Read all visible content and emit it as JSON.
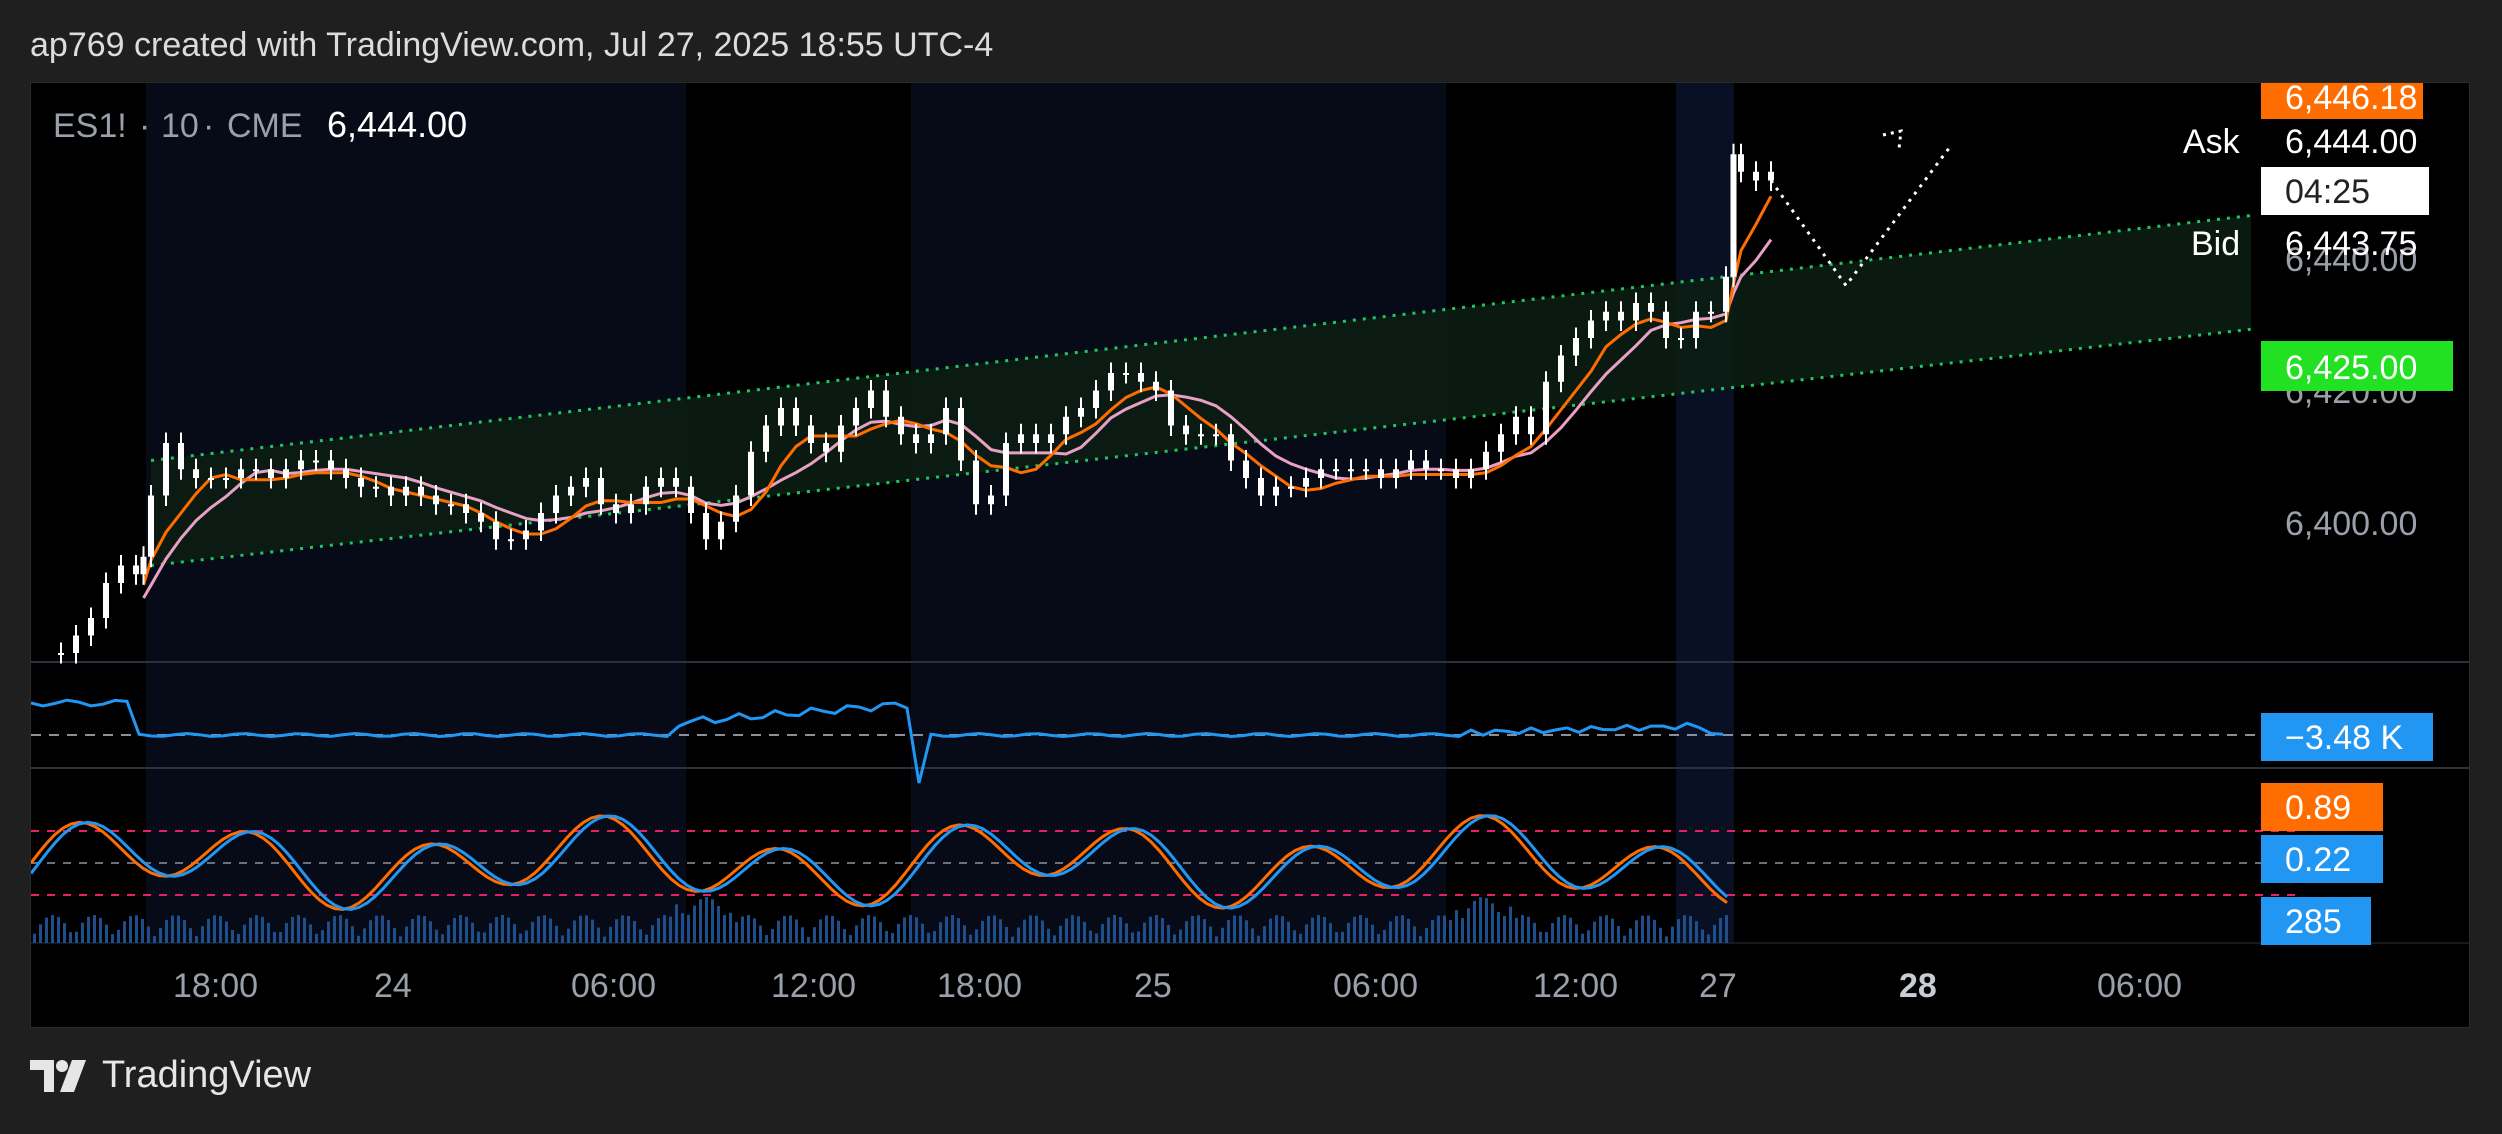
{
  "header": {
    "caption": "ap769 created with TradingView.com, Jul 27, 2025 18:55 UTC-4"
  },
  "footer": {
    "brand": "TradingView"
  },
  "symbol": {
    "ticker": "ES1!",
    "sep1": "·",
    "interval": "10",
    "sep2": "·",
    "exchange": "CME",
    "last": "6,444.00"
  },
  "quote": {
    "ask_label": "Ask",
    "ask_value": "6,444.00",
    "bid_label": "Bid",
    "bid_value": "6,443.75",
    "countdown": "04:25",
    "top_tag": "6,446.18",
    "level_tag": "6,425.00"
  },
  "colors": {
    "up_candle": "#ffffff",
    "orange_line": "#ff6d00",
    "pink_line": "#e8a0c4",
    "channel": "#22c55e",
    "blue": "#2196f3",
    "orange_tag": "#ff6d00",
    "green_tag": "#22e022",
    "pink_dashed": "#e91e63"
  },
  "chart_data": {
    "type": "line",
    "price_axis": {
      "ticks": [
        "6,400.00",
        "6,420.00",
        "6,440.00"
      ],
      "ylim": [
        6388,
        6452
      ]
    },
    "time_axis": {
      "ticks": [
        "18:00",
        "24",
        "06:00",
        "12:00",
        "18:00",
        "25",
        "06:00",
        "12:00",
        "27",
        "28",
        "06:00"
      ]
    },
    "price_series": {
      "x": [
        0,
        10,
        20,
        30,
        40,
        50,
        55,
        60,
        70,
        80,
        90,
        100,
        110,
        120,
        130,
        140,
        150,
        160,
        170,
        180,
        190,
        200,
        210,
        220,
        230,
        240,
        250,
        260,
        270,
        280,
        290,
        300,
        310,
        320,
        330,
        340,
        350,
        360,
        370,
        380,
        390,
        400,
        410,
        420,
        430,
        440,
        450,
        460,
        470,
        480,
        490,
        500,
        510,
        520,
        530,
        540,
        550,
        560,
        570,
        580,
        590,
        600,
        610,
        620,
        630,
        640,
        650,
        660,
        670,
        680,
        690,
        700,
        710,
        720,
        730,
        740,
        750,
        760,
        770,
        780,
        790,
        800,
        810,
        820,
        830,
        840,
        850,
        860,
        870,
        880,
        890,
        900,
        910,
        920,
        930,
        940,
        950,
        960,
        970,
        980,
        990,
        1000,
        1010,
        1020,
        1030,
        1040,
        1050,
        1060,
        1070,
        1080,
        1090,
        1100,
        1110,
        1115,
        1120,
        1130,
        1140
      ],
      "y": [
        6388,
        6390,
        6392,
        6396,
        6398,
        6397,
        6399,
        6406,
        6412,
        6409,
        6408,
        6408,
        6408,
        6409,
        6409,
        6408,
        6409,
        6410,
        6410,
        6409,
        6408,
        6407,
        6407,
        6406,
        6407,
        6406,
        6405,
        6405,
        6404,
        6403,
        6401,
        6401,
        6402,
        6404,
        6406,
        6407,
        6408,
        6405,
        6404,
        6405,
        6407,
        6408,
        6407,
        6404,
        6401,
        6403,
        6406,
        6411,
        6414,
        6416,
        6414,
        6412,
        6411,
        6414,
        6416,
        6418,
        6415,
        6413,
        6412,
        6413,
        6416,
        6410,
        6405,
        6406,
        6412,
        6413,
        6412,
        6413,
        6415,
        6416,
        6418,
        6420,
        6420,
        6419,
        6418,
        6414,
        6413,
        6413,
        6413,
        6410,
        6408,
        6406,
        6407,
        6407,
        6408,
        6409,
        6409,
        6409,
        6409,
        6408,
        6409,
        6410,
        6409,
        6409,
        6408,
        6409,
        6411,
        6413,
        6415,
        6413,
        6419,
        6422,
        6424,
        6426,
        6427,
        6426,
        6428,
        6427,
        6424,
        6424,
        6427,
        6427,
        6431,
        6445,
        6443,
        6442,
        6443
      ],
      "unit": "x-position bucket"
    },
    "future_projection": [
      [
        1140,
        6442
      ],
      [
        1190,
        6430
      ],
      [
        1260,
        6446
      ]
    ],
    "channel_upper": [
      [
        60,
        6410
      ],
      [
        1460,
        6438
      ]
    ],
    "channel_lower": [
      [
        60,
        6398
      ],
      [
        1460,
        6425
      ]
    ],
    "volume_delta_label": "−3.48 K",
    "stoch": {
      "k_label": "0.89",
      "d_label": "0.22",
      "volume_label": "285"
    }
  }
}
